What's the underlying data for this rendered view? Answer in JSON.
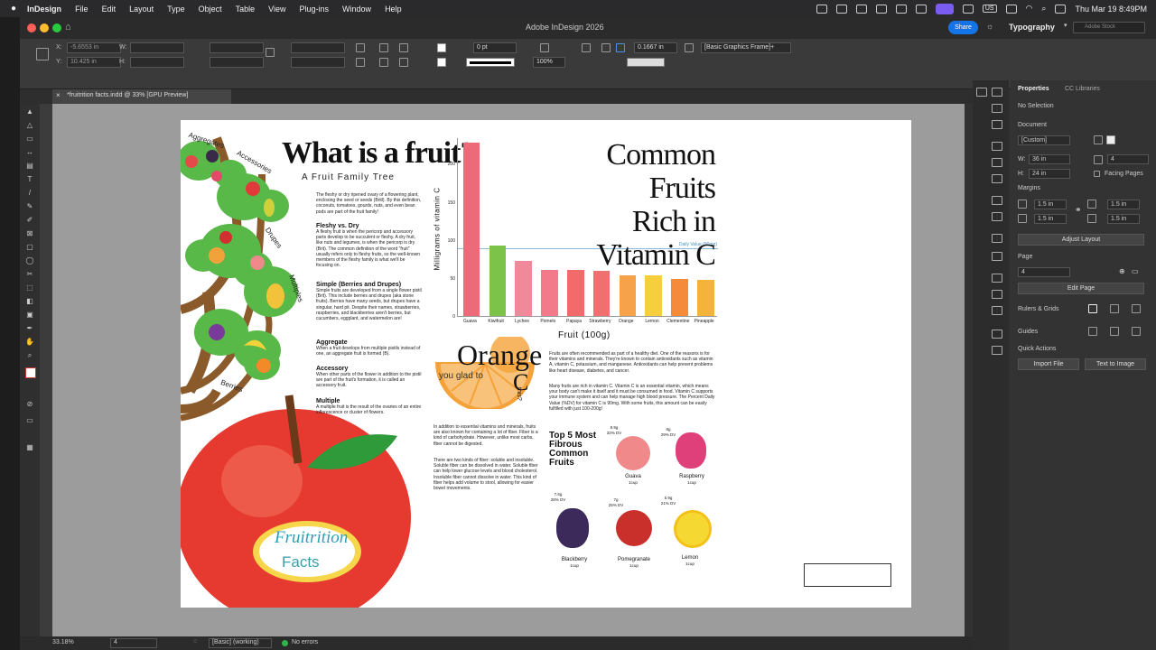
{
  "menubar": {
    "app": "InDesign",
    "items": [
      "File",
      "Edit",
      "Layout",
      "Type",
      "Object",
      "Table",
      "View",
      "Plug-ins",
      "Window",
      "Help"
    ],
    "clock": "Thu Mar 19  8:49PM",
    "input_source": "US"
  },
  "window": {
    "title": "Adobe InDesign 2026",
    "share_label": "Share",
    "workspace": "Typography",
    "search_placeholder": "Adobe Stock"
  },
  "control": {
    "x": "-5.6553 in",
    "y": "10.425 in",
    "w_label": "W:",
    "h_label": "H:",
    "stroke": "0 pt",
    "zoom_pct": "100%",
    "gap": "0.1667 in",
    "frame_style": "[Basic Graphics Frame]+"
  },
  "document_tab": "*fruitrition facts.indd @ 33% [GPU Preview]",
  "status": {
    "zoom": "33.18%",
    "page": "4",
    "profile": "[Basic] (working)",
    "errors": "No errors"
  },
  "panel": {
    "tabs": [
      "Properties",
      "CC Libraries"
    ],
    "selection": "No Selection",
    "document_header": "Document",
    "preset": "[Custom]",
    "width": "36 in",
    "height": "24 in",
    "pages": "4",
    "facing_pages": "Facing Pages",
    "margins_header": "Margins",
    "margin_top": "1.5 in",
    "margin_bottom": "1.5 in",
    "margin_left": "1.5 in",
    "margin_right": "1.5 in",
    "adjust_layout": "Adjust Layout",
    "page_header": "Page",
    "page_value": "4",
    "edit_page": "Edit Page",
    "rulers_grids": "Rulers & Grids",
    "guides": "Guides",
    "quick_actions": "Quick Actions",
    "import_file": "Import File",
    "text_to_image": "Text to Image"
  },
  "spread": {
    "heading": "What is a fruit?",
    "subheading": "A Fruit Family Tree",
    "intro": "The fleshy or dry ripened ovary of a flowering plant, enclosing the seed or seeds (Britl). By this definition, coconuts, tomatoes, gourds, nuts, and even bean pods are part of the fruit family!",
    "sections": [
      {
        "title": "Fleshy vs. Dry",
        "text": "A fleshy fruit is when the pericorp and accessory parts develop to be succulent or fleshy. A dry fruit, like nuts and legumes, is when the pericorp is dry (Brit). The common definition of the word \"fruit\" usually refers only to fleshy fruits, so the well-known members of the fleshy family is what we'll be focusing on."
      },
      {
        "title": "Simple (Berries and Drupes)",
        "text": "Simple fruits are developed from a single flower pistil (Brit). This include berries and drupes (aka stone fruits). Berries have many seeds, but drupes have a singular, hard pit. Despite their names, strawberries, raspberries, and blackberries aren't berries, but cucumbers, eggplant, and watermelon are!"
      },
      {
        "title": "Aggregate",
        "text": "When a fruit develops from multiple pistils instead of one, an aggregate fruit is formed (B)."
      },
      {
        "title": "Accessory",
        "text": "When other parts of the flower in addition to the pistil are part of the fruit's formation, it is called an accessory fruit."
      },
      {
        "title": "Multiple",
        "text": "A multiple fruit is the result of the ovaries of an entire inflorescence or cluster of flowers."
      }
    ],
    "tree_labels": [
      "Aggregates",
      "Accessories",
      "Drupes",
      "Multiples",
      "Berries"
    ],
    "logo_line1": "Fruitrition",
    "logo_line2": "Facts",
    "vitc_title_1": "Common Fruits",
    "vitc_title_2": "Rich in Vitamin C",
    "orange_word": "Orange",
    "orange_sub": "you glad to",
    "orange_c": "C",
    "orange_this": "this?",
    "vitc_text_1": "Fruits are often recommended as part of a healthy diet. One of the reasons is for their vitamins and minerals. They're known to contain antioxidants such as vitamin A, vitamin C, potassium, and manganese. Antioxidants can help prevent problems like heart disease, diabetes, and cancer.",
    "vitc_text_2": "Many fruits are rich in vitamin C. Vitamin C is an essential vitamin, which means your body can't make it itself and it must be consumed in food. Vitamin C supports your immune system and can help manage high blood pressure. The Percent Daily Value (%DV) for vitamin C is 90mg. With some fruits, this amount can be easily fulfilled with just 100-200g!",
    "fiber_text_1": "In addition to essential vitamins and minerals, fruits are also known for containing a lot of fiber. Fiber is a kind of carbohydrate. However, unlike most carbs, fiber cannot be digested.",
    "fiber_text_2": "There are two kinds of fiber: soluble and insoluble. Soluble fiber can be dissolved in water. Soluble fiber can help lower glucose levels and blood cholesterol. Insoluble fiber cannot dissolve in water. This kind of fiber helps add volume to stool, allowing for easier bowel movements.",
    "top5_title": "Top 5 Most Fibrous Common Fruits",
    "fibrous": [
      {
        "name": "Guava",
        "serving": "1cup",
        "grams": "8.9g",
        "dv": "32% DV",
        "color": "#f08a8a"
      },
      {
        "name": "Raspberry",
        "serving": "1cup",
        "grams": "8g",
        "dv": "29% DV",
        "color": "#e0407a"
      },
      {
        "name": "Blackberry",
        "serving": "1cup",
        "grams": "7.6g",
        "dv": "28% DV",
        "color": "#3b2a5a"
      },
      {
        "name": "Pomegranate",
        "serving": "1cup",
        "grams": "7g",
        "dv": "25% DV",
        "color": "#c9302c"
      },
      {
        "name": "Lemon",
        "serving": "1cup",
        "grams": "5.9g",
        "dv": "21% DV",
        "color": "#f6d832"
      }
    ]
  },
  "chart_data": {
    "type": "bar",
    "categories": [
      "Guava",
      "Kiwifruit",
      "Lychee",
      "Pomelo",
      "Papaya",
      "Strawberry",
      "Orange",
      "Lemon",
      "Clementine",
      "Pineapple"
    ],
    "values": [
      228,
      93,
      72,
      61,
      61,
      59,
      53,
      53,
      49,
      48
    ],
    "colors": [
      "#ec6b78",
      "#7cc34a",
      "#f08a9a",
      "#f27a8a",
      "#f26a6a",
      "#f07070",
      "#f6a24a",
      "#f7cf3e",
      "#f58a3a",
      "#f4b43a"
    ],
    "xlabel": "Fruit (100g)",
    "ylabel": "Milligrams of vitamin C",
    "yticks": [
      0,
      50,
      100,
      150,
      200
    ],
    "ylim": [
      0,
      235
    ],
    "reference": {
      "value": 90,
      "label": "Daily Value (90mg)"
    }
  }
}
